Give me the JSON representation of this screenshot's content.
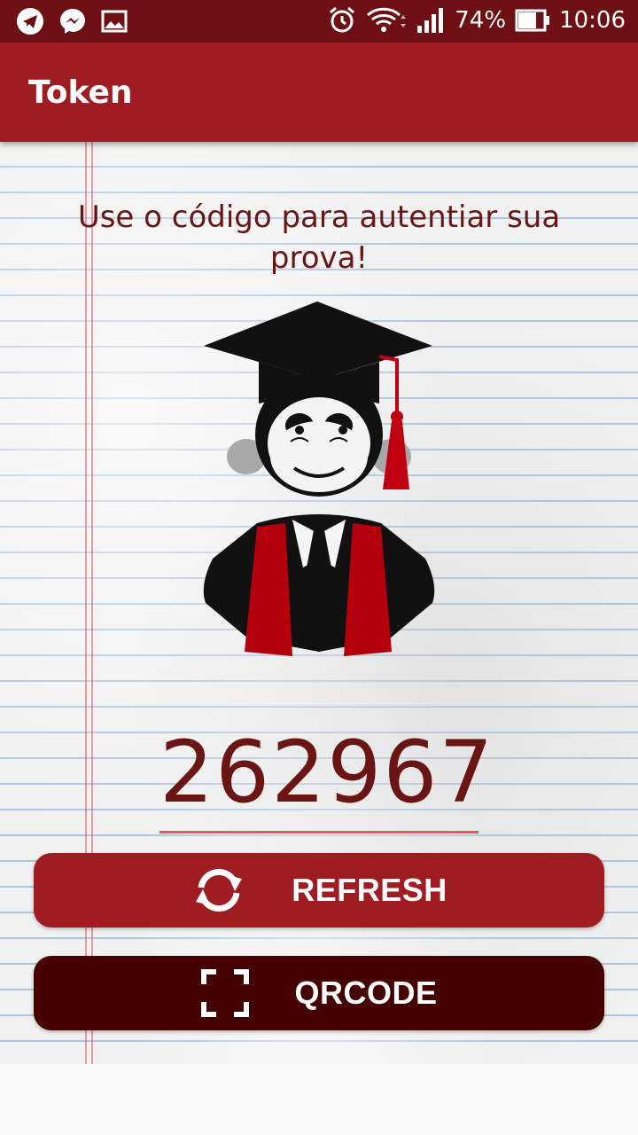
{
  "status_bar": {
    "battery_percent": "74%",
    "time": "10:06",
    "left_icons": [
      "telegram-icon",
      "messenger-icon",
      "gallery-icon"
    ],
    "right_icons": [
      "alarm-icon",
      "wifi-icon",
      "signal-icon",
      "battery-icon"
    ]
  },
  "app_bar": {
    "title": "Token"
  },
  "main": {
    "headline": "Use o código para autentiar sua prova!",
    "token_code": "262967",
    "illustration": "graduate-monkey-icon"
  },
  "buttons": {
    "refresh": {
      "label": "REFRESH",
      "icon": "refresh-icon"
    },
    "qrcode": {
      "label": "QRCODE",
      "icon": "scan-icon"
    }
  },
  "colors": {
    "status_bar": "#6e1013",
    "app_bar": "#9e1c22",
    "refresh_button": "#9e1c22",
    "qrcode_button": "#450000",
    "text_dark_red": "#6a1414",
    "underline": "#e45a5e"
  }
}
